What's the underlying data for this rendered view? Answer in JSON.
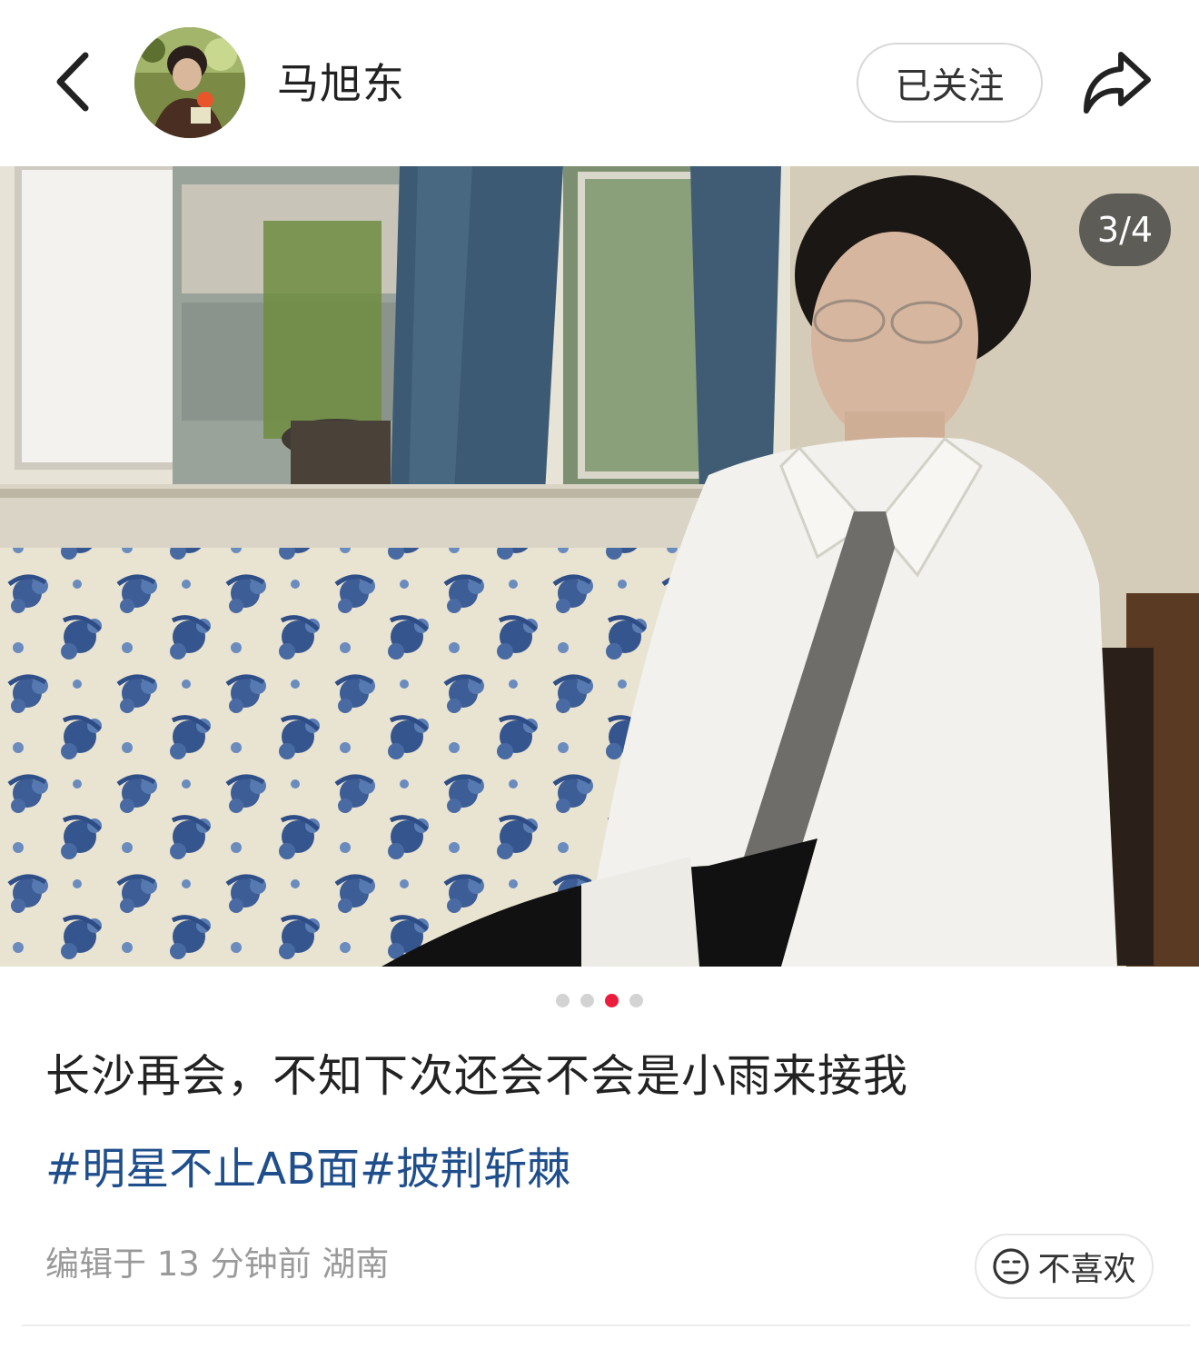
{
  "header": {
    "username": "马旭东",
    "follow_label": "已关注"
  },
  "gallery": {
    "counter": "3/4",
    "total": 4,
    "current": 3
  },
  "post": {
    "title": "长沙再会，不知下次还会不会是小雨来接我",
    "tags": [
      "#明星不止AB面",
      "#披荆斩棘"
    ],
    "meta": "编辑于 13 分钟前 湖南",
    "dislike_label": "不喜欢"
  },
  "icons": {
    "back": "chevron-left-icon",
    "share": "share-arrow-icon",
    "dislike": "neutral-face-icon"
  },
  "colors": {
    "accent_dot": "#ec1c3c",
    "tag": "#1f4e8c",
    "meta": "#9a9a9a"
  }
}
